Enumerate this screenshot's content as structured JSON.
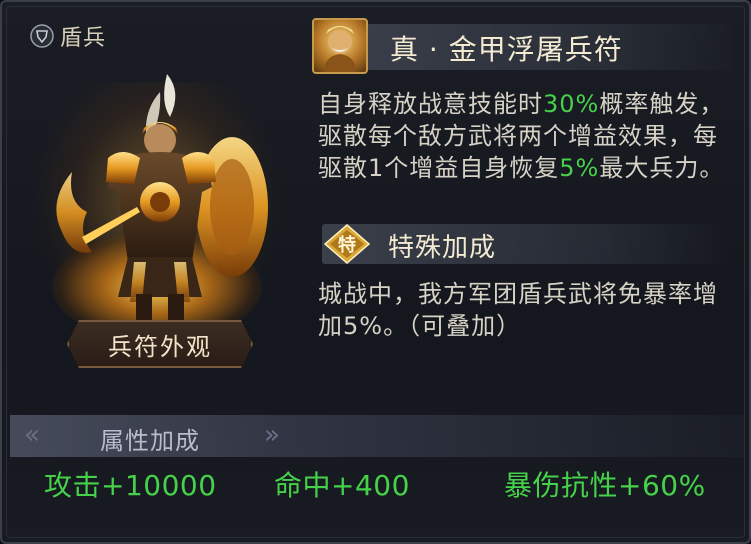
{
  "unit_type": "盾兵",
  "appearance_button_label": "兵符外观",
  "talisman": {
    "name": "真 · 金甲浮屠兵符",
    "description_parts": [
      {
        "text": "自身释放战意技能时",
        "hl": false
      },
      {
        "text": "30%",
        "hl": true
      },
      {
        "text": "概率触发，驱散每个敌方武将两个增益效果，每驱散1个增益自身恢复",
        "hl": false
      },
      {
        "text": "5%",
        "hl": true
      },
      {
        "text": "最大兵力。",
        "hl": false
      }
    ]
  },
  "special_bonus": {
    "badge": "特",
    "title": "特殊加成",
    "description": "城战中，我方军团盾兵武将免暴率增加5%。（可叠加）"
  },
  "attributes": {
    "title": "属性加成",
    "stats": [
      {
        "label": "攻击+10000"
      },
      {
        "label": "命中+400"
      },
      {
        "label": "暴伤抗性+60%"
      }
    ]
  },
  "colors": {
    "highlight": "#46d14a",
    "text": "#d6d2c6",
    "title": "#f3ead2"
  }
}
